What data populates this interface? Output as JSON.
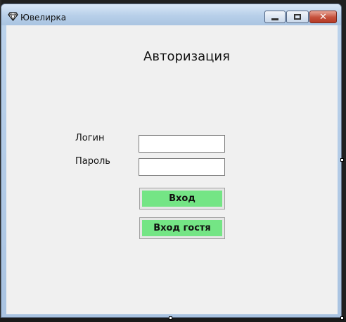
{
  "window": {
    "title": "Ювелирка",
    "app_icon": "diamond-icon",
    "controls": {
      "minimize_icon": "minimize-icon",
      "maximize_icon": "maximize-icon",
      "close_icon": "close-icon",
      "close_glyph": "✕"
    }
  },
  "form": {
    "heading": "Авторизация",
    "login_label": "Логин",
    "password_label": "Пароль",
    "login_value": "",
    "password_value": "",
    "login_button": "Вход",
    "guest_button": "Вход гостя"
  },
  "colors": {
    "button_fill": "#74e585",
    "client_bg": "#f0f0f0",
    "close_button": "#c5503b"
  }
}
